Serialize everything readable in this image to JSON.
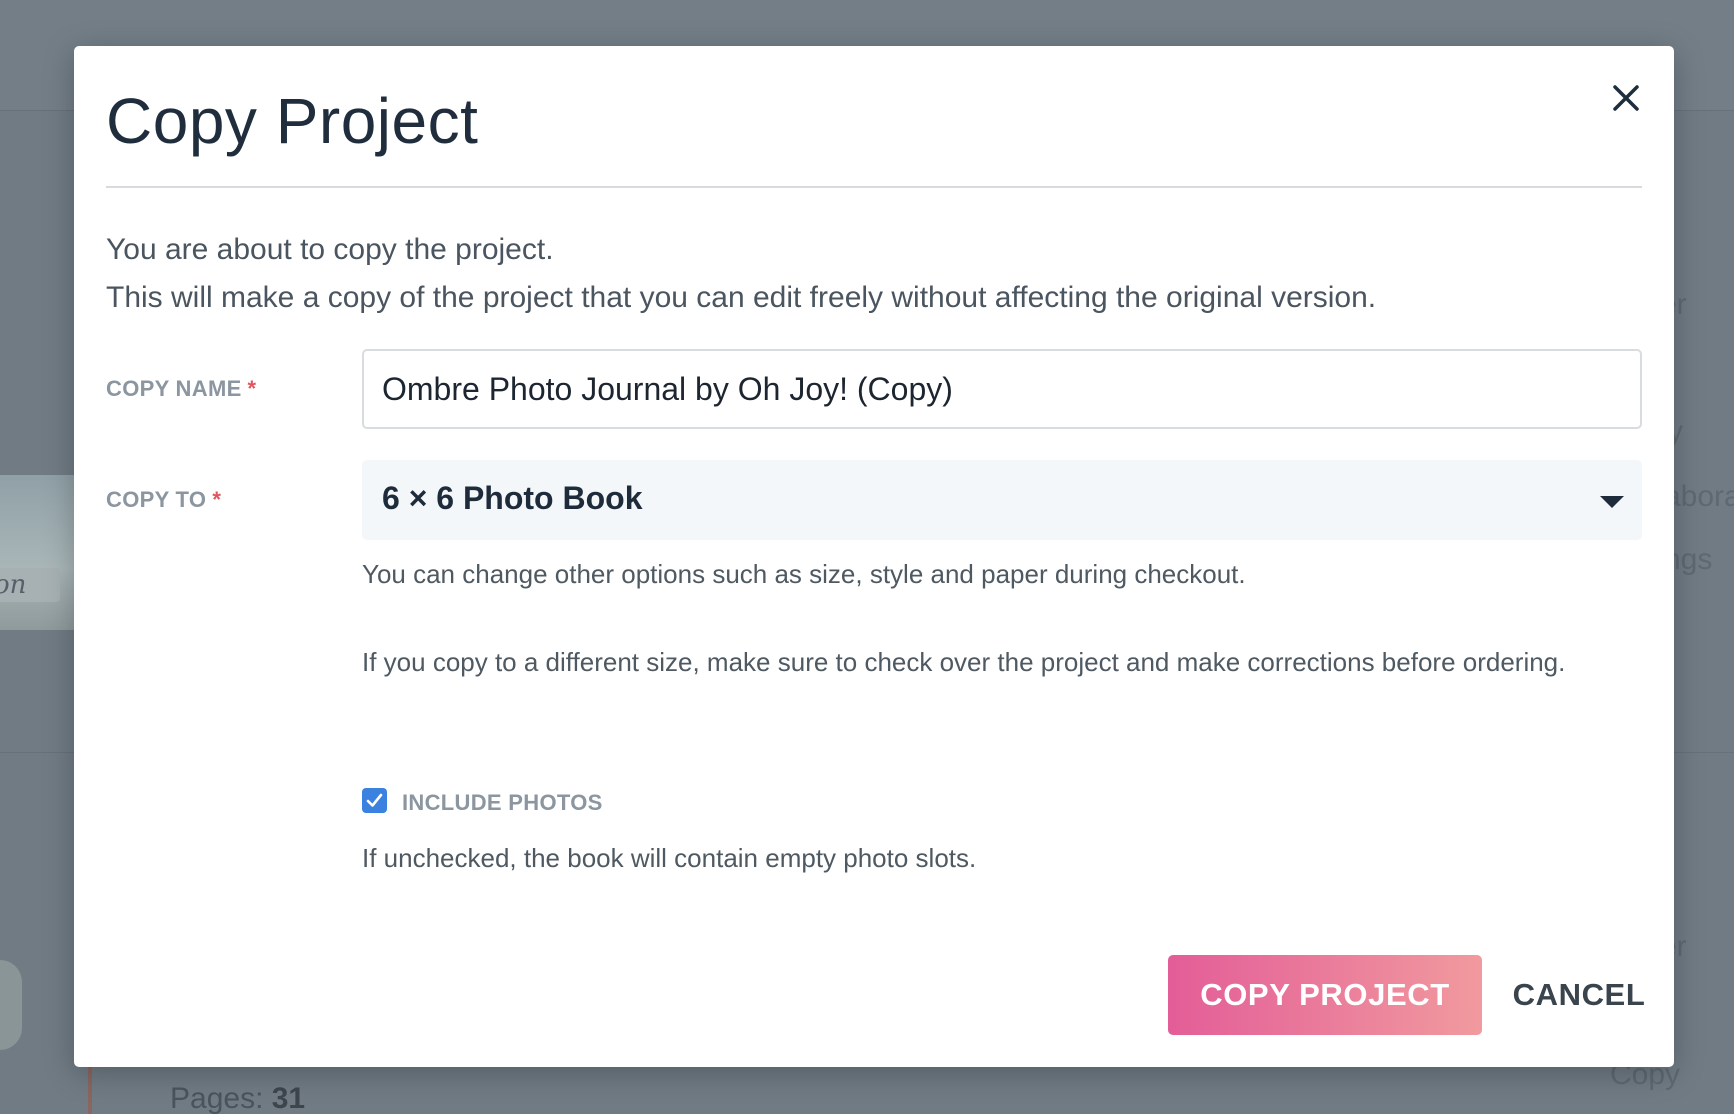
{
  "background": {
    "side_text": [
      "er",
      "y",
      "abora",
      "ngs",
      "er",
      "Copy"
    ],
    "pages_label": "Pages:",
    "pages_value": "31",
    "thumb_label": "on"
  },
  "dialog": {
    "title": "Copy Project",
    "close_icon": "close-icon",
    "intro_line_1": "You are about to copy the project.",
    "intro_line_2": "This will make a copy of the project that you can edit freely without affecting the original version.",
    "copy_name": {
      "label": "COPY NAME",
      "required_marker": "*",
      "value": "Ombre Photo Journal by Oh Joy! (Copy)"
    },
    "copy_to": {
      "label": "COPY TO",
      "required_marker": "*",
      "selected": "6 × 6 Photo Book",
      "caret_icon": "caret-down-icon"
    },
    "help_options": "You can change other options such as size, style and paper during checkout.",
    "help_size": "If you copy to a different size, make sure to check over the project and make corrections before ordering.",
    "include_photos": {
      "label": "INCLUDE PHOTOS",
      "checked": true,
      "help": "If unchecked, the book will contain empty photo slots."
    },
    "buttons": {
      "copy_project": "COPY PROJECT",
      "cancel": "CANCEL"
    }
  },
  "colors": {
    "title": "#1f2d3d",
    "label": "#8b96a0",
    "required": "#e0555e",
    "checkbox": "#3b82e0",
    "primary_gradient_start": "#e35d98",
    "primary_gradient_end": "#f19a9e",
    "overlay": "#707b84"
  }
}
